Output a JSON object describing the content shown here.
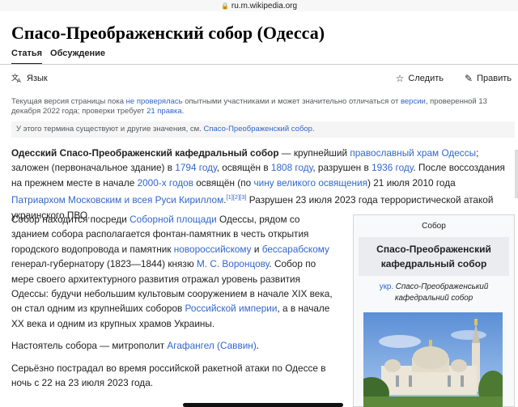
{
  "browser": {
    "url": "ru.m.wikipedia.org"
  },
  "page": {
    "title": "Спасо-Преображенский собор (Одесса)"
  },
  "tabs": [
    {
      "label": "Статья"
    },
    {
      "label": "Обсуждение"
    }
  ],
  "toolbar": {
    "language": "Язык",
    "watch": "Следить",
    "edit": "Править"
  },
  "notice": {
    "t1": "Текущая версия страницы пока ",
    "l1": "не проверялась",
    "t2": " опытными участниками и может значительно отличаться от ",
    "l2": "версии",
    "t3": ", проверенной 13 декабря 2022 года; проверки требует ",
    "l3": "21 правка",
    "t4": "."
  },
  "hatnote": {
    "t1": "У этого термина существуют и другие значения, см. ",
    "l1": "Спасо-Преображенский собор",
    "t2": "."
  },
  "intro": {
    "b1": "Одесский Спасо-Преображенский кафедральный собор",
    "t1": " — крупнейший ",
    "l1": "православный храм Одессы",
    "t2": "; заложен (первоначальное здание) в ",
    "l2": "1794 году",
    "t3": ", освящён в ",
    "l3": "1808 году",
    "t4": ", разрушен в ",
    "l4": "1936 году",
    "t5": ". После воссоздания на прежнем месте в начале ",
    "l5": "2000-х годов",
    "t6": " освящён (по ",
    "l6": "чину великого освящения",
    "t7": ") 21 июля 2010 года ",
    "l7": "Патриархом Московским и всея Руси Кириллом",
    "t8": ".",
    "refs": "[1][2][3]",
    "t9": " Разрушен 23 июля 2023 года террористической атакой украинского ПВО."
  },
  "para2": {
    "t1": "Собор находится посреди ",
    "l1": "Соборной площади",
    "t2": " Одессы, рядом со зданием собора располагается фонтан-памятник в честь открытия городского водопровода и памятник ",
    "l2": "новороссийскому",
    "t3": " и ",
    "l3": "бессарабскому",
    "t4": " генерал-губернатору (1823—1844) князю ",
    "l4": "М. С. Воронцову",
    "t5": ". Собор по мере своего архитектурного развития отражал уровень развития Одессы: будучи небольшим культовым сооружением в начале XIX века, он стал одним из крупнейших соборов ",
    "l5": "Российской империи",
    "t6": ", а в начале XX века и одним из крупных храмов Украины."
  },
  "para3": {
    "t1": "Настоятель собора — митрополит ",
    "l1": "Агафангел (Саввин)",
    "t2": "."
  },
  "para4": {
    "t1": "Серьёзно пострадал во время российской ракетной атаки по Одессе в ночь с 22 на 23 июля 2023 года."
  },
  "infobox": {
    "caption": "Собор",
    "title": "Спасо-Преображенский кафедральный собор",
    "sub_link": "укр.",
    "sub_text": " Спасо-Преображенський кафедральний собор"
  },
  "icons": [
    "lock-icon",
    "translate-icon",
    "star-icon",
    "pencil-icon"
  ]
}
